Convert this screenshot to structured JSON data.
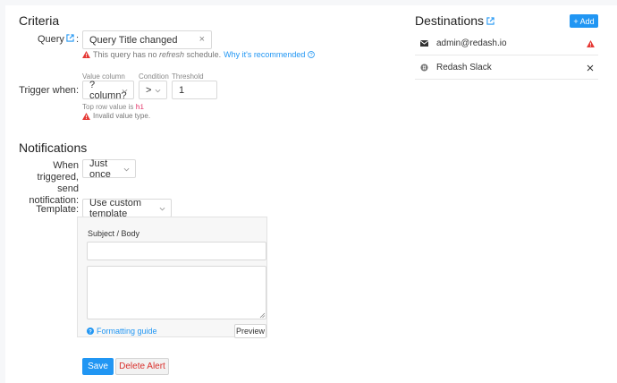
{
  "criteria": {
    "heading": "Criteria",
    "query_label": "Query",
    "query_value": "Query Title changed",
    "refresh_warning_pre": "This query has no ",
    "refresh_warning_em": "refresh",
    "refresh_warning_post": " schedule.",
    "refresh_warning_link": "Why it's recommended",
    "trigger_label": "Trigger when",
    "value_column_caption": "Value column",
    "value_column_value": "?column?",
    "condition_caption": "Condition",
    "condition_value": ">",
    "threshold_caption": "Threshold",
    "threshold_value": "1",
    "top_row_text": "Top row value is ",
    "top_row_value": "hi",
    "invalid_value_text": "Invalid value type."
  },
  "notifications": {
    "heading": "Notifications",
    "when_triggered_line1": "When triggered,",
    "when_triggered_line2": "send notification",
    "when_triggered_value": "Just once",
    "template_label": "Template",
    "template_value": "Use custom template",
    "subject_body_label": "Subject / Body",
    "subject_placeholder": "",
    "body_placeholder": "",
    "formatting_guide": "Formatting guide",
    "preview_button": "Preview"
  },
  "actions": {
    "save": "Save",
    "delete": "Delete Alert"
  },
  "destinations": {
    "heading": "Destinations",
    "add_button": "+ Add",
    "items": [
      {
        "name": "admin@redash.io",
        "icon": "envelope-icon",
        "end_icon": "warning-icon"
      },
      {
        "name": "Redash Slack",
        "icon": "slack-icon",
        "end_icon": "close-icon"
      }
    ]
  },
  "colors": {
    "accent": "#2196f3",
    "danger": "#d9302c",
    "warning": "#e53935",
    "background": "#f6f7f9",
    "panel": "#ffffff"
  }
}
